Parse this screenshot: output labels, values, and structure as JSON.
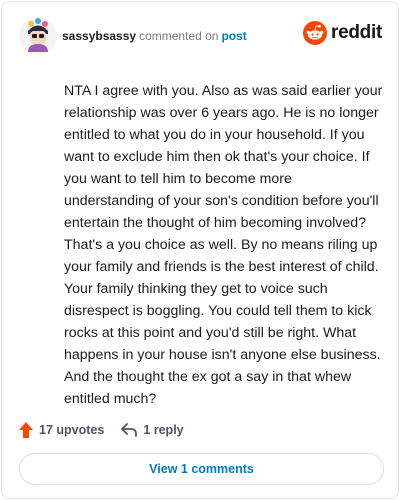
{
  "comment": {
    "username": "sassybsassy",
    "action_text": "commented on",
    "post_link": "post",
    "body": "NTA I agree with you. Also as was said earlier your relationship was over 6 years ago. He is no longer entitled to what you do in your household. If you want to exclude him then ok that's your choice. If you want to tell him to become more understanding of your son's condition before you'll entertain the thought of him becoming involved? That's a you choice as well. By no means riling up your family and friends is the best interest of child. Your family thinking they get to voice such disrespect is boggling. You could tell them to kick rocks at this point and you'd still be right. What happens in your house isn't anyone else business. And the thought the ex got a say in that whew entitled much?"
  },
  "brand": {
    "name": "reddit",
    "icon": "reddit-snoo-icon",
    "color": "#ff4500"
  },
  "actions": {
    "upvotes": "17 upvotes",
    "replies": "1 reply",
    "upvote_icon": "upvote-arrow-icon",
    "reply_icon": "reply-arrow-icon",
    "upvote_color": "#ff4500"
  },
  "footer": {
    "view_comments": "View 1 comments"
  }
}
